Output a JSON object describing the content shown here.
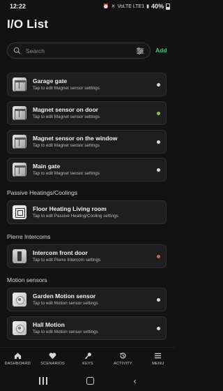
{
  "status_bar": {
    "time": "12:22",
    "network": "VoLTE LTE1",
    "battery": "40%"
  },
  "page": {
    "title": "I/O List"
  },
  "search": {
    "placeholder": "Search",
    "add_label": "Add"
  },
  "colors": {
    "accent": "#3cc98a",
    "status_green": "#7ac943",
    "status_red": "#e0574a",
    "status_idle": "#d9d9d9"
  },
  "cards_group1": [
    {
      "name": "Garage gate",
      "subtitle": "Tap to edit Magnet sensor settings",
      "icon": "gate-icon",
      "status": "idle"
    },
    {
      "name": "Magnet sensor on door",
      "subtitle": "Tap to edit Magnet sensor settings",
      "icon": "gate-icon",
      "status": "green"
    },
    {
      "name": "Magnet sensor on the window",
      "subtitle": "Tap to edit Magnet sensor settings",
      "icon": "gate-icon",
      "status": "idle"
    },
    {
      "name": "Main gate",
      "subtitle": "Tap to edit Magnet sensor settings",
      "icon": "gate-icon",
      "status": "idle"
    }
  ],
  "sections": [
    {
      "title": "Passive Heatings/Coolings",
      "items": [
        {
          "name": "Floor Heating Living room",
          "subtitle": "Tap to edit Passive Heating/Cooling settings",
          "icon": "thermostat-icon",
          "status": "none"
        }
      ]
    },
    {
      "title": "Pierre Intercoms",
      "items": [
        {
          "name": "Intercom  front door",
          "subtitle": "Tap to edit Pierre Intercom settings",
          "icon": "intercom-icon",
          "status": "red"
        }
      ]
    },
    {
      "title": "Motion sensors",
      "items": [
        {
          "name": "Garden Motion sensor",
          "subtitle": "Tap to edit Motion sensor settings",
          "icon": "motion-sensor-icon",
          "status": "idle"
        },
        {
          "name": "Hall Motion",
          "subtitle": "Tap to edit Motion sensor settings",
          "icon": "motion-sensor-icon",
          "status": "idle"
        }
      ]
    }
  ],
  "bottom_nav": [
    {
      "label": "DASHBOARD",
      "icon": "home-icon"
    },
    {
      "label": "SCENARIOS",
      "icon": "heart-icon"
    },
    {
      "label": "KEYS",
      "icon": "key-icon"
    },
    {
      "label": "ACTIVITY",
      "icon": "history-icon"
    },
    {
      "label": "MENU",
      "icon": "menu-icon"
    }
  ]
}
